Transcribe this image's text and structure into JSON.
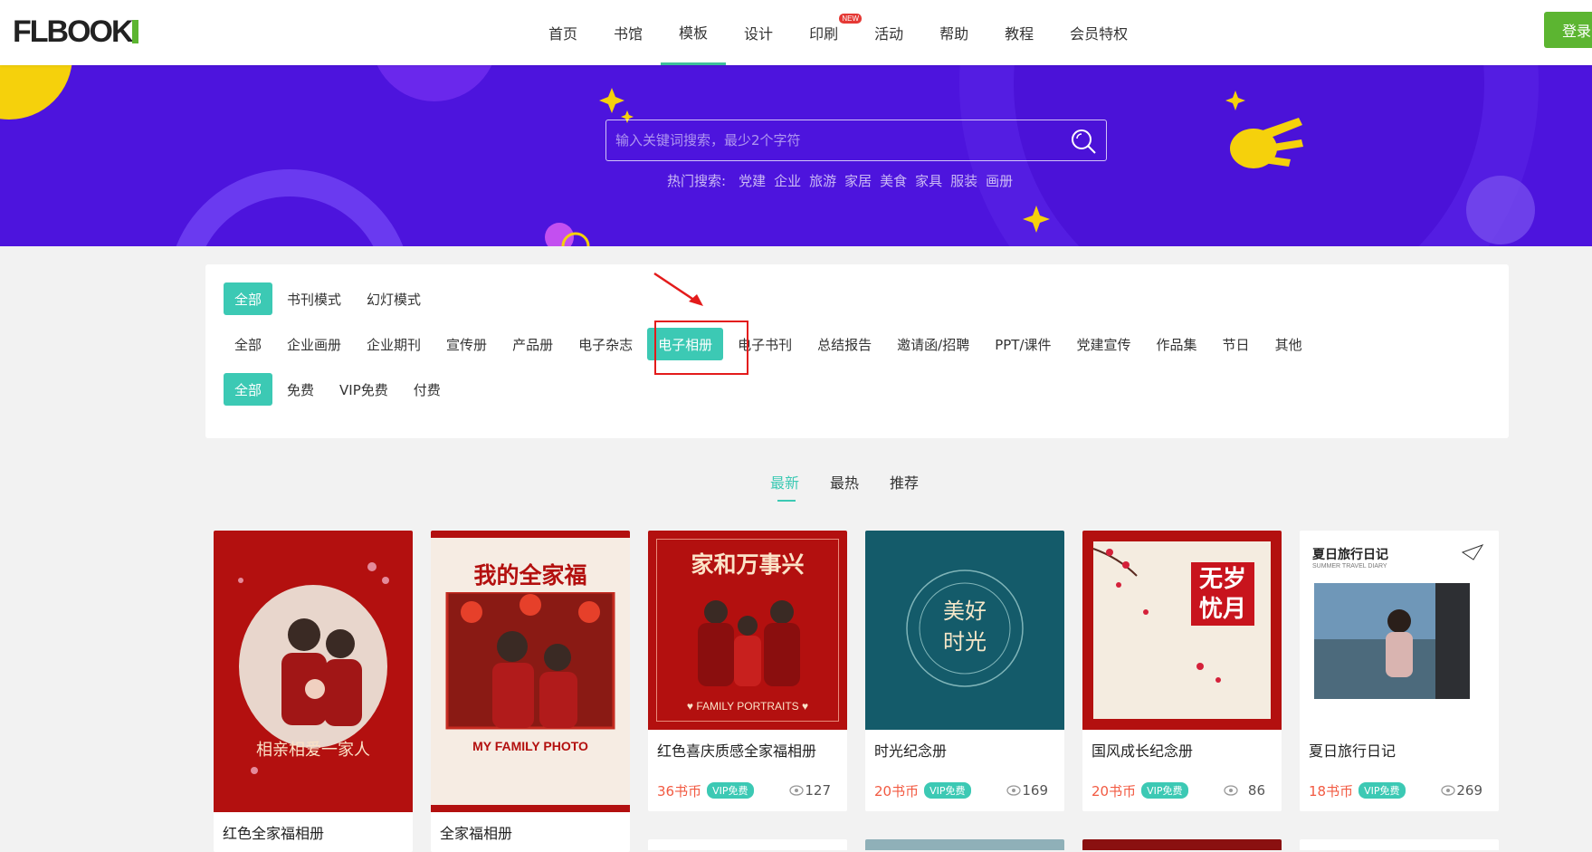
{
  "header": {
    "logo_text": "FLBOOK",
    "nav": [
      {
        "label": "首页"
      },
      {
        "label": "书馆"
      },
      {
        "label": "模板",
        "active": true
      },
      {
        "label": "设计"
      },
      {
        "label": "印刷",
        "badge": "NEW"
      },
      {
        "label": "活动"
      },
      {
        "label": "帮助"
      },
      {
        "label": "教程"
      },
      {
        "label": "会员特权"
      }
    ],
    "login_label": "登录"
  },
  "banner": {
    "search_placeholder": "输入关键词搜索，最少2个字符",
    "hot_label": "热门搜索:",
    "hot_items": [
      "党建",
      "企业",
      "旅游",
      "家居",
      "美食",
      "家具",
      "服装",
      "画册"
    ]
  },
  "filters": {
    "modes": [
      "全部",
      "书刊模式",
      "幻灯模式"
    ],
    "categories": [
      "全部",
      "企业画册",
      "企业期刊",
      "宣传册",
      "产品册",
      "电子杂志",
      "电子相册",
      "电子书刊",
      "总结报告",
      "邀请函/招聘",
      "PPT/课件",
      "党建宣传",
      "作品集",
      "节日",
      "其他"
    ],
    "prices": [
      "全部",
      "免费",
      "VIP免费",
      "付费"
    ],
    "selected_mode": "全部",
    "selected_category": "电子相册",
    "selected_price": "全部"
  },
  "sort_tabs": [
    {
      "label": "最新",
      "active": true
    },
    {
      "label": "最热"
    },
    {
      "label": "推荐"
    }
  ],
  "cards": [
    {
      "title": "红色全家福相册",
      "thumb_text": "相亲相爱一家人"
    },
    {
      "title": "全家福相册",
      "thumb_text": "我的全家福",
      "thumb_sub": "MY FAMILY PHOTO"
    },
    {
      "title": "红色喜庆质感全家福相册",
      "thumb_text": "家和万事兴",
      "thumb_sub": "♥ FAMILY PORTRAITS ♥",
      "price": "36书币",
      "vip": "VIP免费",
      "views": "127"
    },
    {
      "title": "时光纪念册",
      "thumb_text": "美好时光",
      "price": "20书币",
      "vip": "VIP免费",
      "views": "169"
    },
    {
      "title": "国风成长纪念册",
      "thumb_text": "无岁忧月",
      "price": "20书币",
      "vip": "VIP免费",
      "views": "86"
    },
    {
      "title": "夏日旅行日记",
      "thumb_text": "夏日旅行日记",
      "thumb_sub": "SUMMER TRAVEL DIARY",
      "price": "18书币",
      "vip": "VIP免费",
      "views": "269"
    }
  ],
  "colors": {
    "accent": "#3cc9b4",
    "banner": "#4d14dd",
    "login": "#5cb531",
    "price": "#f25a42",
    "highlight": "#e31b1b"
  }
}
